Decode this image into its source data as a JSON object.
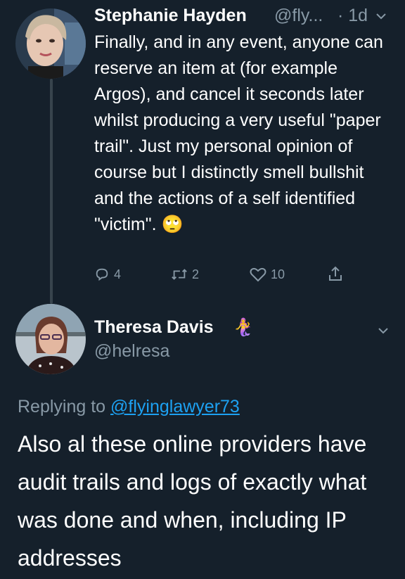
{
  "tweet1": {
    "name": "Stephanie Hayden",
    "handle": "@fly...",
    "time": "· 1d",
    "text": "Finally, and in any event, anyone can reserve an item at (for example Argos), and cancel it seconds later whilst producing a very useful \"paper trail\". Just my personal opinion of course but I distinctly smell bullshit and the actions of a self identified \"victim\".",
    "emoji": "🙄",
    "reply_count": "4",
    "retweet_count": "2",
    "like_count": "10"
  },
  "tweet2": {
    "name": "Theresa Davis",
    "name_emoji": "🧜‍♀️",
    "handle": "@helresa",
    "replying_prefix": "Replying to",
    "replying_user": "@flyinglawyer73",
    "text": "Also al these online providers have audit trails and logs of exactly what was done and when, including IP addresses"
  },
  "colors": {
    "background": "#15202b",
    "secondary_text": "#8899a6",
    "link": "#1da1f2",
    "thread_line": "#38444d"
  }
}
